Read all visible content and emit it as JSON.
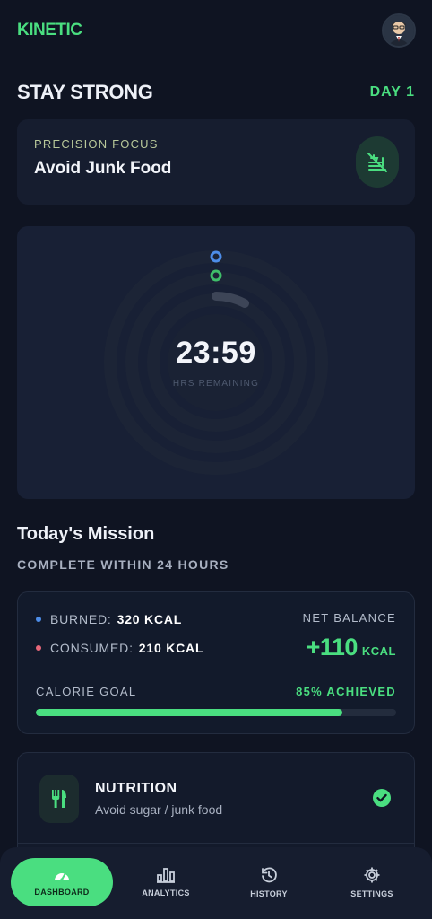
{
  "app": {
    "brand": "KINETIC"
  },
  "header": {
    "title": "STAY STRONG",
    "day": "DAY 1"
  },
  "focus": {
    "eyebrow": "PRECISION FOCUS",
    "title": "Avoid Junk Food",
    "icon": "no-food-icon"
  },
  "timer": {
    "value": "23:59",
    "caption": "HRS REMAINING",
    "colors": {
      "ring_outer": "#4d8de8",
      "ring_middle": "#3fbf6a",
      "ring_inner": "#3d4557"
    }
  },
  "mission": {
    "title": "Today's Mission",
    "subtitle": "COMPLETE WITHIN 24 HOURS"
  },
  "stats": {
    "burned_label": "BURNED:",
    "burned_value": "320 KCAL",
    "consumed_label": "CONSUMED:",
    "consumed_value": "210 KCAL",
    "net_label": "NET BALANCE",
    "net_value": "+110",
    "net_unit": "KCAL",
    "goal_label": "CALORIE GOAL",
    "goal_achieved": "85% ACHIEVED",
    "goal_progress": 0.85,
    "colors": {
      "burned": "#4d8de8",
      "consumed": "#e8687a",
      "accent": "#4ade80"
    }
  },
  "tasks": [
    {
      "title": "NUTRITION",
      "subtitle": "Avoid sugar / junk food",
      "icon": "utensils-icon",
      "done": true
    }
  ],
  "nav": [
    {
      "label": "DASHBOARD",
      "icon": "gauge-icon",
      "active": true
    },
    {
      "label": "ANALYTICS",
      "icon": "bar-chart-icon",
      "active": false
    },
    {
      "label": "HISTORY",
      "icon": "history-icon",
      "active": false
    },
    {
      "label": "SETTINGS",
      "icon": "gear-icon",
      "active": false
    }
  ]
}
